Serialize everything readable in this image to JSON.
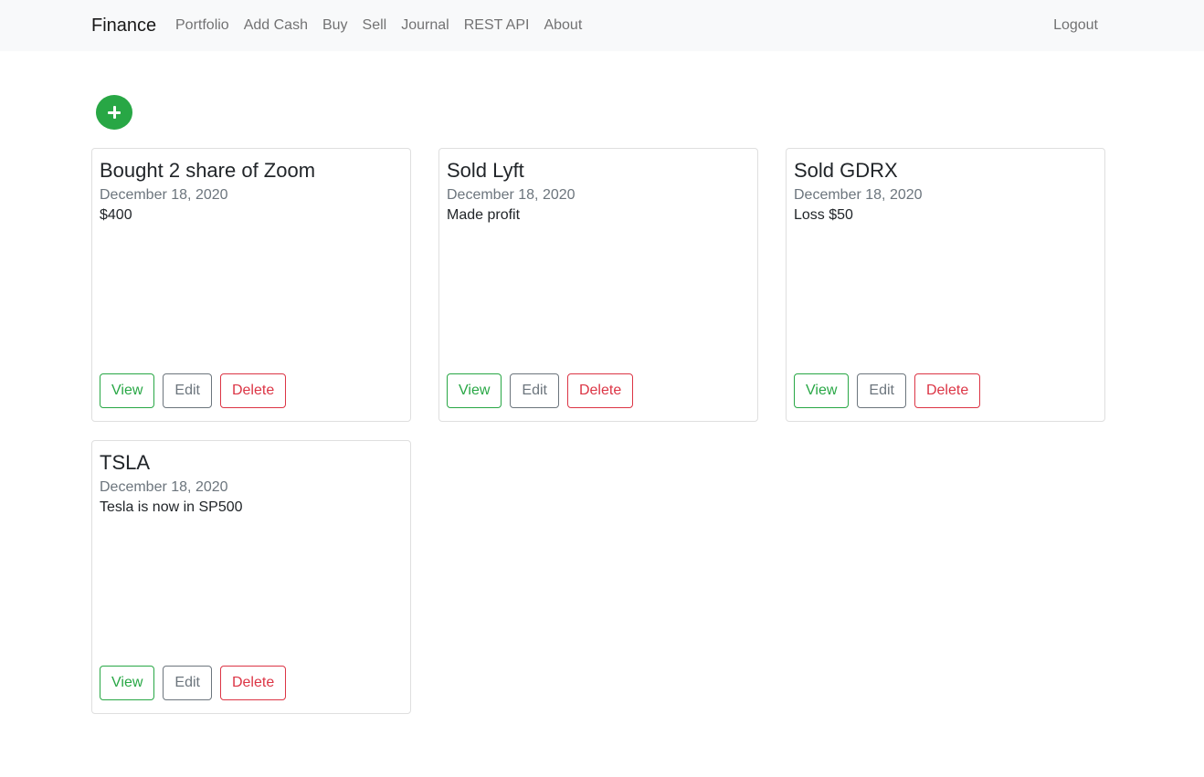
{
  "navbar": {
    "brand": "Finance",
    "links": [
      "Portfolio",
      "Add Cash",
      "Buy",
      "Sell",
      "Journal",
      "REST API",
      "About"
    ],
    "logout": "Logout"
  },
  "add_button": {
    "icon": "plus-icon",
    "color": "#28a745"
  },
  "buttons": {
    "view": "View",
    "edit": "Edit",
    "delete": "Delete"
  },
  "cards": [
    {
      "title": "Bought 2 share of Zoom",
      "date": "December 18, 2020",
      "text": "$400"
    },
    {
      "title": "Sold Lyft",
      "date": "December 18, 2020",
      "text": "Made profit"
    },
    {
      "title": "Sold GDRX",
      "date": "December 18, 2020",
      "text": "Loss $50"
    },
    {
      "title": "TSLA",
      "date": "December 18, 2020",
      "text": "Tesla is now in SP500"
    }
  ],
  "colors": {
    "success": "#28a745",
    "secondary": "#6c757d",
    "danger": "#dc3545",
    "navbar_bg": "#f8f9fa"
  }
}
